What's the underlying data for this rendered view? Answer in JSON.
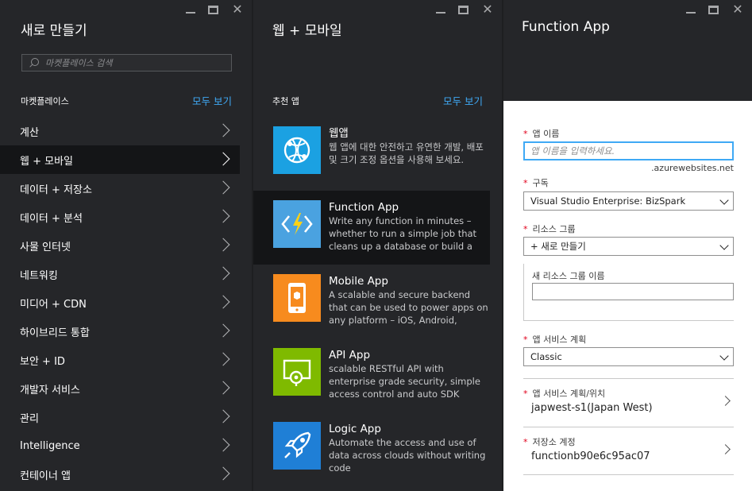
{
  "blade1": {
    "title": "새로 만들기",
    "search_placeholder": "마켓플레이스 검색",
    "section_label": "마켓플레이스",
    "see_all": "모두 보기",
    "categories": [
      {
        "label": "계산"
      },
      {
        "label": "웹 + 모바일"
      },
      {
        "label": "데이터 + 저장소"
      },
      {
        "label": "데이터 + 분석"
      },
      {
        "label": "사물 인터넷"
      },
      {
        "label": "네트워킹"
      },
      {
        "label": "미디어 + CDN"
      },
      {
        "label": "하이브리드 통합"
      },
      {
        "label": "보안 + ID"
      },
      {
        "label": "개발자 서비스"
      },
      {
        "label": "관리"
      },
      {
        "label": "Intelligence"
      },
      {
        "label": "컨테이너 앱"
      }
    ]
  },
  "blade2": {
    "title": "웹 + 모바일",
    "section_label": "추천 앱",
    "see_all": "모두 보기",
    "apps": [
      {
        "name": "웹앱",
        "desc": "웹 앱에 대한 안전하고 유연한 개발, 배포 및 크기 조정 옵션을 사용해 보세요.",
        "color": "#1ba1e2",
        "icon": "globe-icon"
      },
      {
        "name": "Function App",
        "desc": "Write any function in minutes – whether to run a simple job that cleans up a database or build a",
        "color": "#4aa2e0",
        "icon": "lightning-icon"
      },
      {
        "name": "Mobile App",
        "desc": "A scalable and secure backend that can be used to power apps on any platform – iOS, Android, Windows or",
        "color": "#f78b1e",
        "icon": "mobile-icon"
      },
      {
        "name": "API App",
        "desc": "scalable RESTful API with enterprise grade security, simple access control and auto SDK generation",
        "color": "#7fba00",
        "icon": "api-icon"
      },
      {
        "name": "Logic App",
        "desc": "Automate the access and use of data across clouds without writing code",
        "color": "#1f7fd6",
        "icon": "rocket-icon"
      }
    ]
  },
  "blade3": {
    "title": "Function App",
    "req_mark": "*",
    "app_name_label": "앱 이름",
    "app_name_placeholder": "앱 이름을 입력하세요.",
    "app_name_suffix": ".azurewebsites.net",
    "subscription_label": "구독",
    "subscription_value": "Visual Studio Enterprise: BizSpark",
    "resource_group_label": "리소스 그룹",
    "resource_group_value": "+ 새로 만들기",
    "new_rg_label": "새 리소스 그룹 이름",
    "new_rg_value": "",
    "plan_label": "앱 서비스 계획",
    "plan_value": "Classic",
    "plan_location_label": "앱 서비스 계획/위치",
    "plan_location_value": "japwest-s1(Japan West)",
    "storage_label": "저장소 계정",
    "storage_value": "functionb90e6c95ac07"
  },
  "colors": {
    "accent": "#3fa9f5",
    "required": "#e0001b",
    "blade_bg": "#252629",
    "active_bg": "#141517"
  }
}
